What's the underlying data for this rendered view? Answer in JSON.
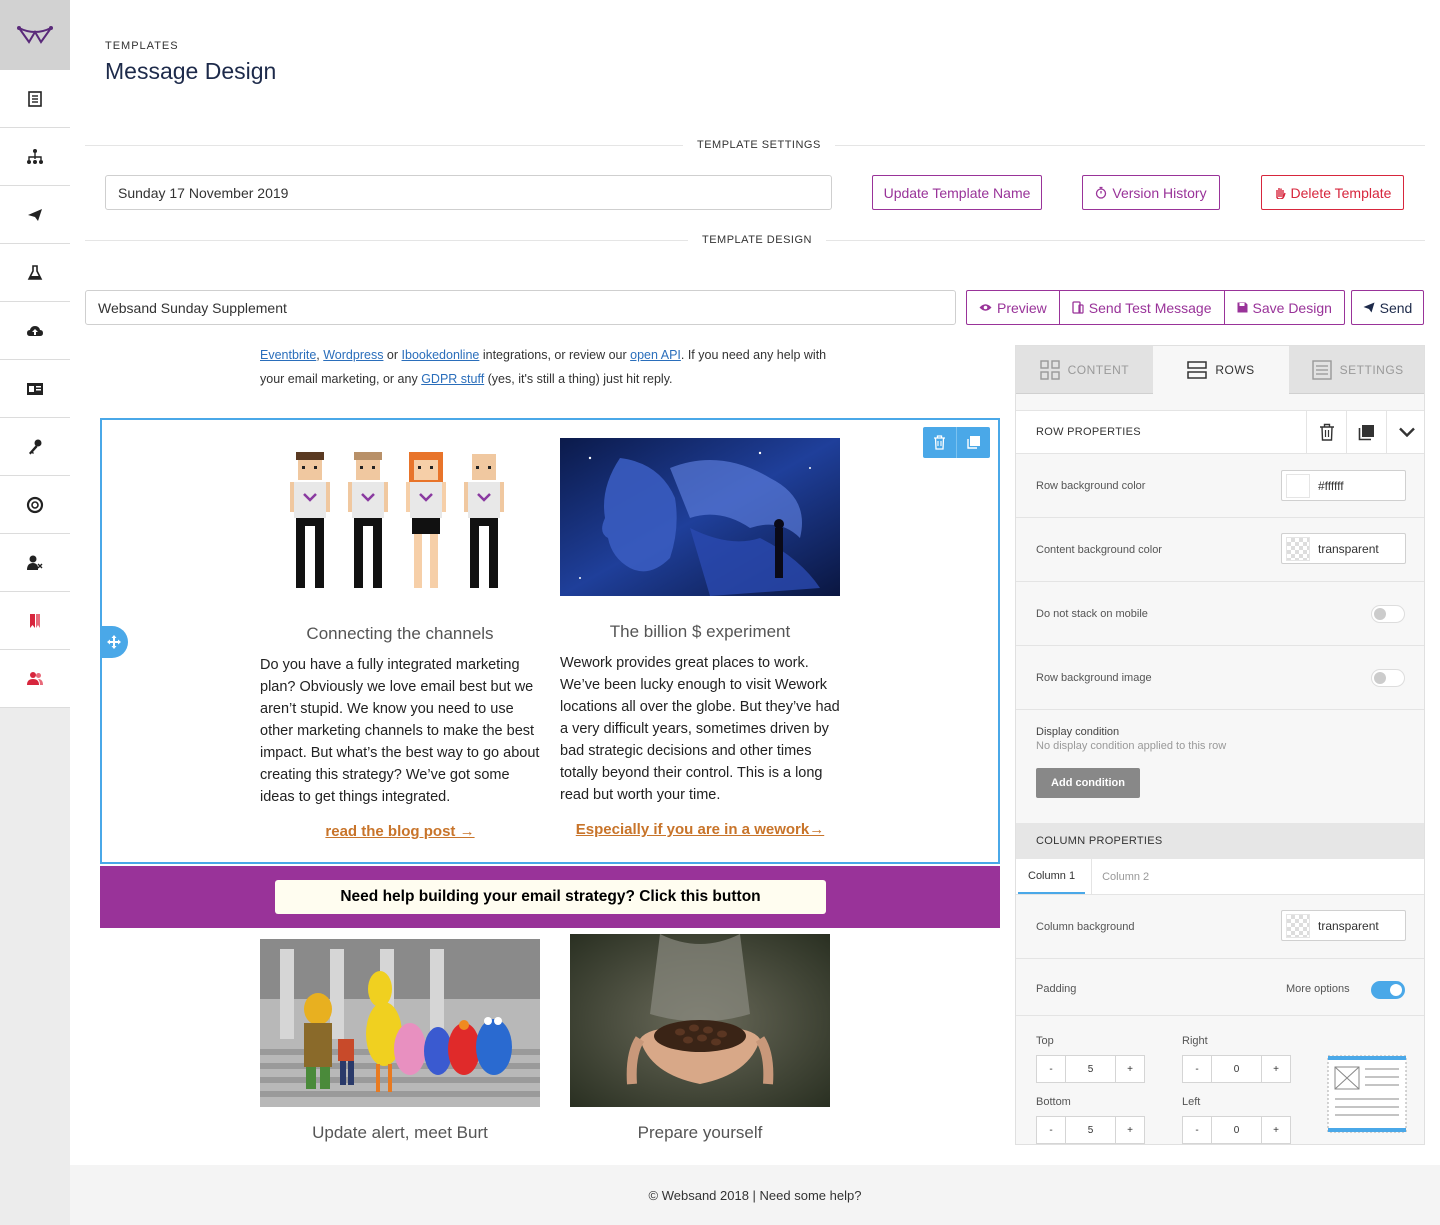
{
  "header": {
    "kicker": "TEMPLATES",
    "title": "Message Design"
  },
  "settings": {
    "section_label": "TEMPLATE SETTINGS",
    "template_name": "Sunday 17 November 2019",
    "update_label": "Update Template Name",
    "history_label": "Version History",
    "delete_label": "Delete Template"
  },
  "design": {
    "section_label": "TEMPLATE DESIGN",
    "subject": "Websand Sunday Supplement",
    "preview_label": "Preview",
    "test_label": "Send Test Message",
    "save_label": "Save Design",
    "send_label": "Send"
  },
  "canvas": {
    "intro": {
      "link1": "Eventbrite",
      "sep1": ", ",
      "link2": "Wordpress",
      "t1": " or ",
      "link3": "Ibookedonline",
      "t2": " integrations, or review our ",
      "link4": "open API",
      "t3": ".  If you need any help with your email marketing, or any ",
      "link5": "GDPR stuff",
      "t4": " (yes, it's still a thing) just hit reply."
    },
    "col1": {
      "title": "Connecting the channels",
      "text": "Do you have a fully integrated marketing plan? Obviously we love email best but we aren’t stupid. We know you need to use other marketing channels to make the best impact.  But what’s the best way to go about creating this strategy?  We’ve got some ideas to get things integrated.",
      "link": "read the blog post →"
    },
    "col2": {
      "title": "The billion $ experiment",
      "text": "Wework provides great places to work. We’ve been lucky enough to visit Wework locations all over the globe. But they’ve had a very difficult years, sometimes driven by bad strategic decisions and other times totally beyond their control. This is a long read but worth your time.",
      "link": "Especially if you are in a wework→"
    },
    "cta": "Need help building your email strategy? Click this button",
    "col3_title": "Update alert, meet Burt",
    "col4_title": "Prepare yourself"
  },
  "panel": {
    "tabs": [
      "CONTENT",
      "ROWS",
      "SETTINGS"
    ],
    "row_props": "ROW PROPERTIES",
    "row_bg_label": "Row background color",
    "row_bg_value": "#ffffff",
    "content_bg_label": "Content background color",
    "content_bg_value": "transparent",
    "no_stack_label": "Do not stack on mobile",
    "row_bg_image_label": "Row background image",
    "display_cond_label": "Display condition",
    "display_cond_sub": "No display condition applied to this row",
    "add_condition": "Add condition",
    "col_props": "COLUMN PROPERTIES",
    "col_tabs": [
      "Column 1",
      "Column 2"
    ],
    "col_bg_label": "Column background",
    "col_bg_value": "transparent",
    "padding_label": "Padding",
    "more_options": "More options",
    "top_label": "Top",
    "top_value": "5",
    "right_label": "Right",
    "right_value": "0",
    "bottom_label": "Bottom",
    "bottom_value": "5",
    "left_label": "Left",
    "left_value": "0",
    "minus": "-",
    "plus": "+"
  },
  "footer": "© Websand 2018 | Need some help?",
  "colors": {
    "accent": "#993399",
    "selection": "#4aa8e8",
    "danger": "#d7263d",
    "link": "#c8742a"
  }
}
